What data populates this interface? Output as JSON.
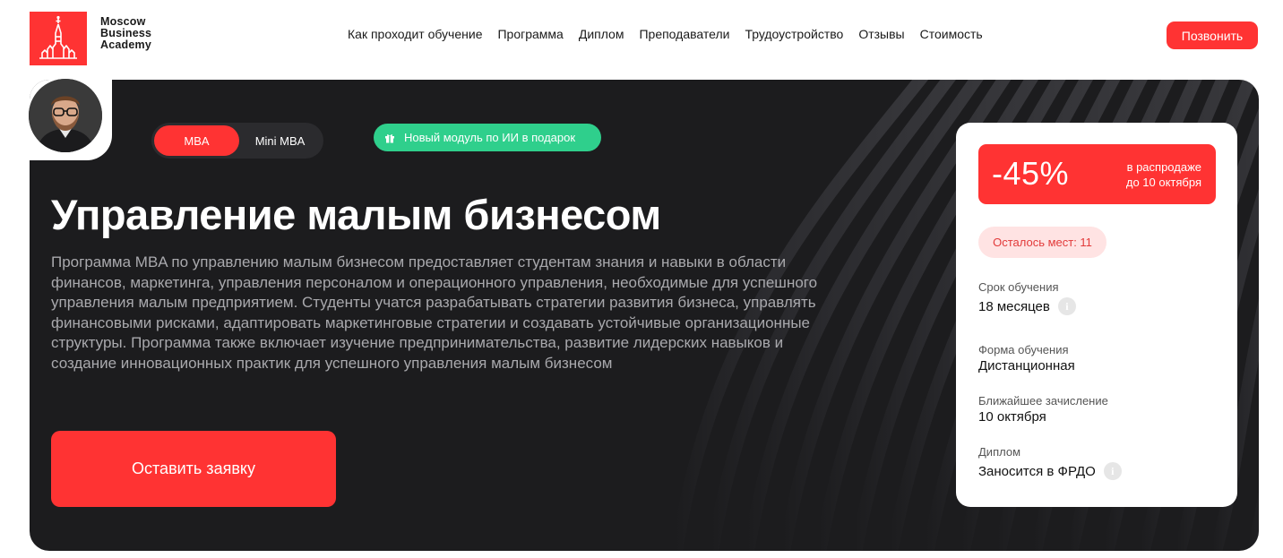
{
  "brand": {
    "name_lines": [
      "Moscow",
      "Business",
      "Academy"
    ]
  },
  "nav": [
    "Как проходит обучение",
    "Программа",
    "Диплом",
    "Преподаватели",
    "Трудоустройство",
    "Отзывы",
    "Стоимость"
  ],
  "header": {
    "call_label": "Позвонить"
  },
  "hero": {
    "toggle": {
      "mba": "MBA",
      "mini": "Mini MBA"
    },
    "ai_badge": "Новый модуль по ИИ в подарок",
    "title": "Управление малым бизнесом",
    "description": "Программа MBA по управлению малым бизнесом предоставляет студентам знания и навыки в области финансов, маркетинга, управления персоналом и операционного управления, необходимые для успешного управления малым предприятием. Студенты учатся разрабатывать стратегии развития бизнеса, управлять финансовыми рисками, адаптировать маркетинговые стратегии и создавать устойчивые организационные структуры. Программа также включает изучение предпринимательства, развитие лидерских навыков и создание инновационных практик для успешного управления малым бизнесом",
    "apply_label": "Оставить заявку"
  },
  "card": {
    "discount": "-45%",
    "sale_line1": "в распродаже",
    "sale_line2": "до 10 октября",
    "seats": "Осталось мест: 11",
    "duration_label": "Срок обучения",
    "duration_value": "18 месяцев",
    "form_label": "Форма обучения",
    "form_value": "Дистанционная",
    "enroll_label": "Ближайшее зачисление",
    "enroll_value": "10 октября",
    "diploma_label": "Диплом",
    "diploma_value": "Заносится в ФРДО",
    "info_glyph": "i"
  },
  "colors": {
    "accent": "#ff3333",
    "hero_bg": "#1c1c1e",
    "ai_badge": "#2fcf8c"
  }
}
